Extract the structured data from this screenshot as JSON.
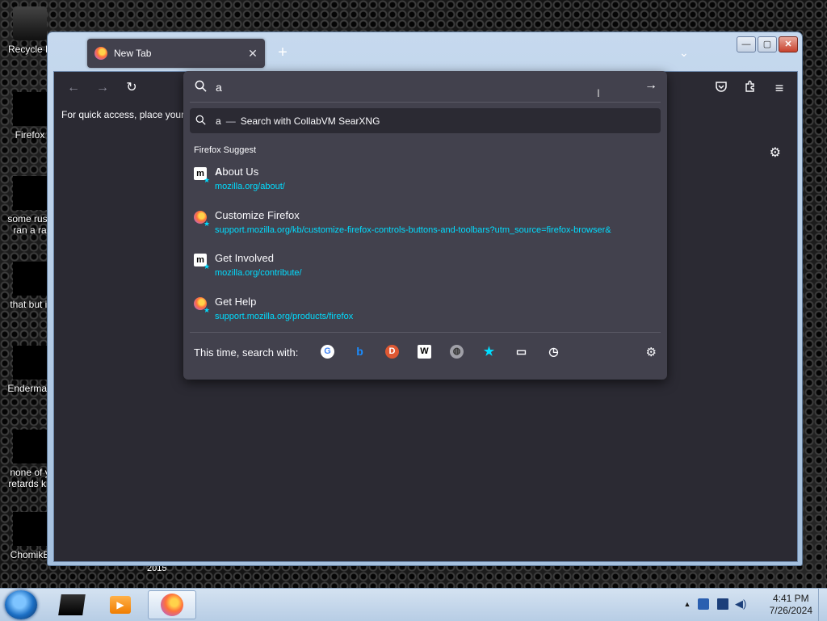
{
  "desktop": {
    "icons": [
      {
        "label": "Recycle Bin",
        "shown": "Recycle E"
      },
      {
        "label": "Firefox"
      },
      {
        "label": "some russ... ran a ra...",
        "line1": "some russ",
        "line2": "ran a ra"
      },
      {
        "label": "that but it",
        "line1": "that but it"
      },
      {
        "label": "Enderman",
        "line1": "Enderman"
      },
      {
        "label": "none of y... retards kn...",
        "line1": "none of y",
        "line2": "retards kn"
      },
      {
        "label": "ChomikB",
        "line1": "ChomikB"
      }
    ],
    "year_label": "2015"
  },
  "window": {
    "tab": {
      "title": "New Tab",
      "close": "✕"
    },
    "new_tab": "+",
    "tab_list": "⌄",
    "controls": {
      "minimize": "—",
      "maximize": "▢",
      "close": "✕"
    },
    "nav": {
      "back": "←",
      "forward": "→",
      "reload": "↻"
    },
    "bookmarks_text": "For quick access, place your b",
    "toolbar_icons": {
      "pocket": "pocket-icon",
      "extensions": "extensions-icon",
      "menu": "≡"
    },
    "settings_gear": "⚙"
  },
  "urlbar": {
    "value": "a",
    "go": "→",
    "search_row": {
      "query": "a",
      "dash": "—",
      "label": "Search with CollabVM SearXNG"
    },
    "suggest_heading": "Firefox Suggest",
    "suggestions": [
      {
        "title_bold": "A",
        "title_rest": "bout Us",
        "url": "mozilla.org/about/",
        "favicon": "mozilla"
      },
      {
        "title_bold": "",
        "title_rest": "Customize Firefox",
        "url": "support.mozilla.org/kb/customize-firefox-controls-buttons-and-toolbars?utm_source=firefox-browser&",
        "favicon": "firefox"
      },
      {
        "title_bold": "",
        "title_rest": "Get Involved",
        "url": "mozilla.org/contribute/",
        "favicon": "mozilla"
      },
      {
        "title_bold": "",
        "title_rest": "Get Help",
        "url": "support.mozilla.org/products/firefox",
        "favicon": "firefox"
      }
    ],
    "engines_label": "This time, search with:",
    "engines": [
      {
        "name": "google-icon",
        "glyph": "G",
        "color": "#4285f4",
        "bg": "#ffffff"
      },
      {
        "name": "bing-icon",
        "glyph": "b",
        "color": "#1a8cff",
        "bg": "transparent"
      },
      {
        "name": "duckduckgo-icon",
        "glyph": "D",
        "color": "#ffffff",
        "bg": "#de5833"
      },
      {
        "name": "wikipedia-icon",
        "glyph": "W",
        "color": "#000000",
        "bg": "#ffffff"
      },
      {
        "name": "searxng-icon",
        "glyph": "◍",
        "color": "#333333",
        "bg": "#a0a0a8"
      },
      {
        "name": "bookmarks-icon",
        "glyph": "★",
        "color": "#00ddff",
        "bg": "transparent"
      },
      {
        "name": "tabs-icon",
        "glyph": "▭",
        "color": "#fbfbfe",
        "bg": "transparent"
      },
      {
        "name": "history-icon",
        "glyph": "◷",
        "color": "#fbfbfe",
        "bg": "transparent"
      }
    ],
    "settings": "⚙"
  },
  "taskbar": {
    "time": "4:41 PM",
    "date": "7/26/2024",
    "tray_arrow": "▲"
  },
  "colors": {
    "popup_bg": "#42414d",
    "page_bg": "#2b2a33",
    "accent_link": "#00ddff",
    "text": "#fbfbfe"
  }
}
